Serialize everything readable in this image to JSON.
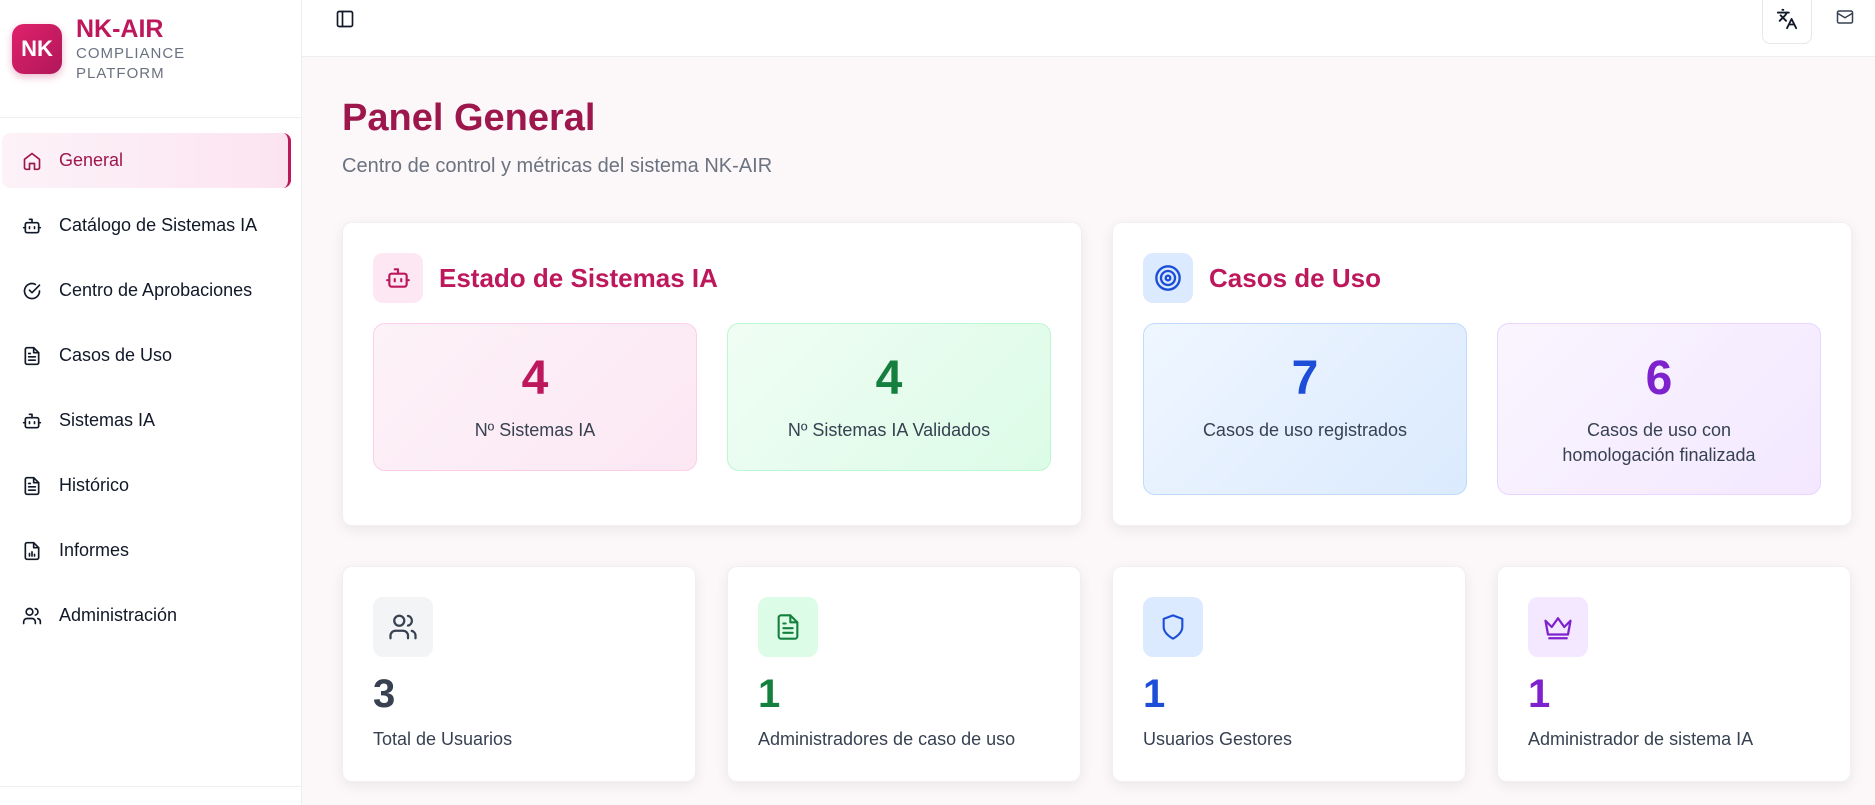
{
  "brand": {
    "logo_text": "NK",
    "name": "NK-AIR",
    "subtitle_line1": "COMPLIANCE",
    "subtitle_line2": "PLATFORM"
  },
  "sidebar": {
    "items": [
      {
        "label": "General",
        "icon": "home-icon",
        "active": true
      },
      {
        "label": "Catálogo de Sistemas IA",
        "icon": "bot-icon"
      },
      {
        "label": "Centro de Aprobaciones",
        "icon": "check-circle-icon"
      },
      {
        "label": "Casos de Uso",
        "icon": "file-text-icon"
      },
      {
        "label": "Sistemas IA",
        "icon": "bot-icon"
      },
      {
        "label": "Histórico",
        "icon": "file-text-icon"
      },
      {
        "label": "Informes",
        "icon": "report-icon"
      },
      {
        "label": "Administración",
        "icon": "users-icon"
      }
    ]
  },
  "topbar": {
    "toggle_icon": "sidebar-toggle-icon",
    "language_icon": "translate-icon",
    "mail_icon": "mail-icon"
  },
  "header": {
    "title": "Panel General",
    "subtitle": "Centro de control y métricas del sistema NK-AIR"
  },
  "panels": {
    "systems": {
      "title": "Estado de Sistemas IA",
      "icon": "bot-icon",
      "stats": [
        {
          "value": "4",
          "label": "Nº Sistemas IA",
          "color": "#be185d"
        },
        {
          "value": "4",
          "label": "Nº Sistemas IA Validados",
          "color": "#15803d"
        }
      ]
    },
    "use_cases": {
      "title": "Casos de Uso",
      "icon": "target-icon",
      "stats": [
        {
          "value": "7",
          "label": "Casos de uso registrados",
          "color": "#1d4ed8"
        },
        {
          "value": "6",
          "label": "Casos de uso con homologación finalizada",
          "color": "#7e22ce"
        }
      ]
    }
  },
  "cards": [
    {
      "value": "3",
      "label": "Total de Usuarios",
      "icon": "users-icon",
      "color": "#374151"
    },
    {
      "value": "1",
      "label": "Administradores de caso de uso",
      "icon": "file-text-icon",
      "color": "#15803d"
    },
    {
      "value": "1",
      "label": "Usuarios Gestores",
      "icon": "shield-icon",
      "color": "#1d4ed8"
    },
    {
      "value": "1",
      "label": "Administrador de sistema IA",
      "icon": "crown-icon",
      "color": "#7e22ce"
    }
  ]
}
